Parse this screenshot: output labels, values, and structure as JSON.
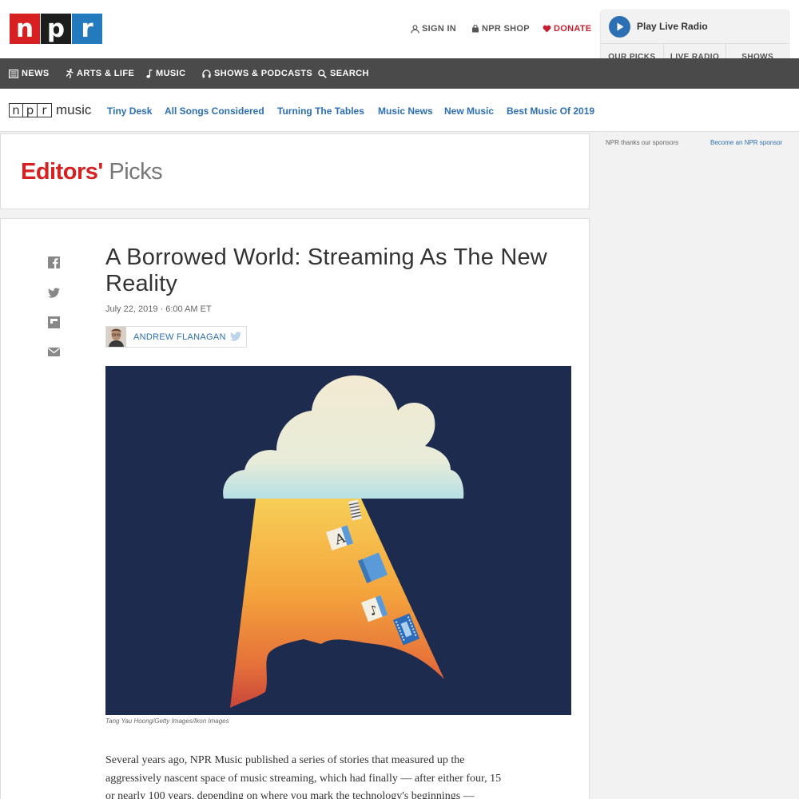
{
  "topbar": {
    "logo": {
      "n": "n",
      "p": "p",
      "r": "r"
    },
    "sign_in": "SIGN IN",
    "shop": "NPR SHOP",
    "donate": "DONATE"
  },
  "player": {
    "label": "Play Live Radio",
    "tabs": [
      "OUR PICKS",
      "LIVE RADIO",
      "SHOWS"
    ]
  },
  "main_nav": [
    "NEWS",
    "ARTS & LIFE",
    "MUSIC",
    "SHOWS & PODCASTS",
    "SEARCH"
  ],
  "music_nav": {
    "logo": {
      "n": "n",
      "p": "p",
      "r": "r",
      "word": "music"
    },
    "items": [
      "Tiny Desk",
      "All Songs Considered",
      "Turning The Tables",
      "Music News",
      "New Music",
      "Best Music Of 2019"
    ]
  },
  "sponsor": {
    "thanks": "NPR thanks our sponsors",
    "link": "Become an NPR sponsor"
  },
  "picks": {
    "first": "Editors'",
    "second": "Picks"
  },
  "article": {
    "headline": "A Borrowed World: Streaming As The New Reality",
    "date": "July 22, 2019 · 6:00 AM ET",
    "author": "ANDREW FLANAGAN",
    "caption": "Tang Yau Hoong/Getty Images/Ikon Images",
    "body": "Several years ago, NPR Music published a series of stories that measured up the aggressively nascent space of music streaming, which had finally — after either four, 15 or nearly 100 years, depending on where you mark the technology's beginnings — achieved an irreversible"
  },
  "icons": {
    "sign_in": "user-icon",
    "shop": "bag-icon",
    "donate": "heart-icon",
    "play": "play-icon",
    "news": "newspaper-icon",
    "arts": "dancer-icon",
    "music": "music-note-icon",
    "shows": "headphones-icon",
    "search": "search-icon",
    "share": [
      "facebook-icon",
      "twitter-icon",
      "flipboard-icon",
      "email-icon"
    ]
  },
  "colors": {
    "brand_red": "#d62021",
    "link_blue": "#2c6fb2",
    "nav_bg": "#4a4a4a",
    "hero_bg": "#1c2b4e"
  }
}
